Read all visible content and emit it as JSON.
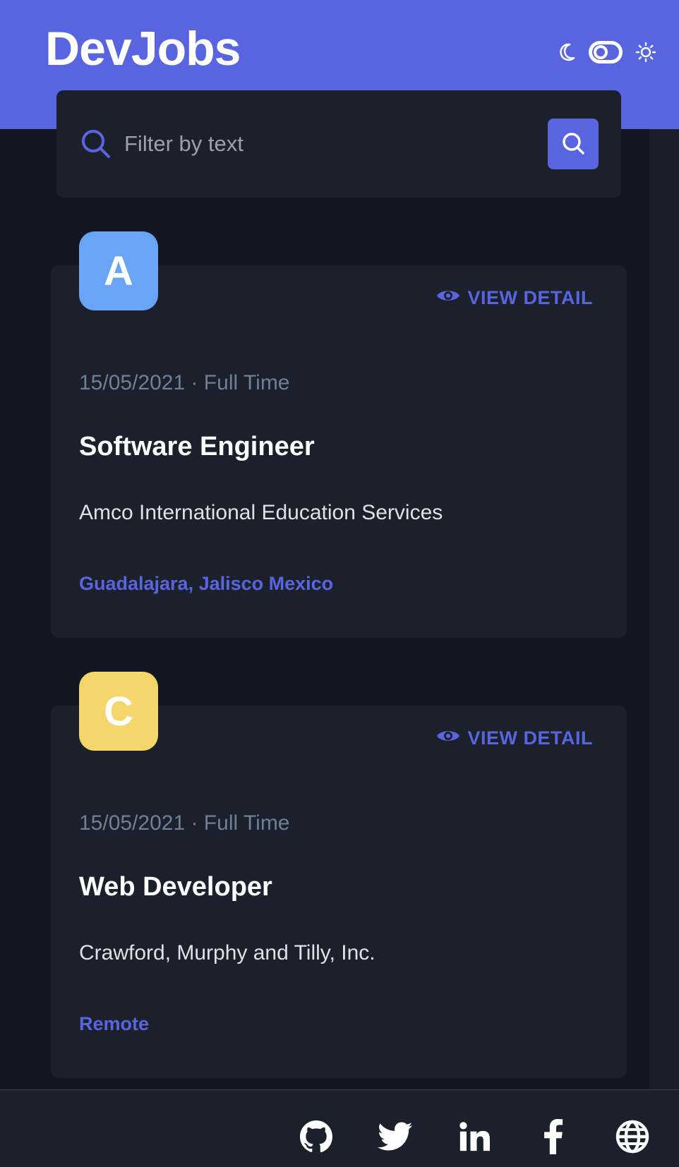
{
  "app": {
    "logo": "DevJobs"
  },
  "theme_toggle": {
    "moon_icon": "moon-icon",
    "sun_icon": "sun-icon",
    "mode": "dark"
  },
  "search": {
    "placeholder": "Filter by text",
    "value": "",
    "icon": "search-icon"
  },
  "jobs": [
    {
      "logo_letter": "A",
      "logo_color": "#6aa4f4",
      "view_detail_label": "VIEW DETAIL",
      "meta": "15/05/2021 · Full Time",
      "title": "Software Engineer",
      "company": "Amco International Education Services",
      "location": "Guadalajara, Jalisco Mexico"
    },
    {
      "logo_letter": "C",
      "logo_color": "#f4d66a",
      "view_detail_label": "VIEW DETAIL",
      "meta": "15/05/2021 · Full Time",
      "title": "Web Developer",
      "company": "Crawford, Murphy and Tilly, Inc.",
      "location": "Remote"
    }
  ],
  "footer": {
    "links": [
      "github-icon",
      "twitter-icon",
      "linkedin-icon",
      "facebook-icon",
      "globe-icon"
    ]
  },
  "colors": {
    "accent": "#5964e0",
    "background": "#121721",
    "card": "#1c202b"
  }
}
